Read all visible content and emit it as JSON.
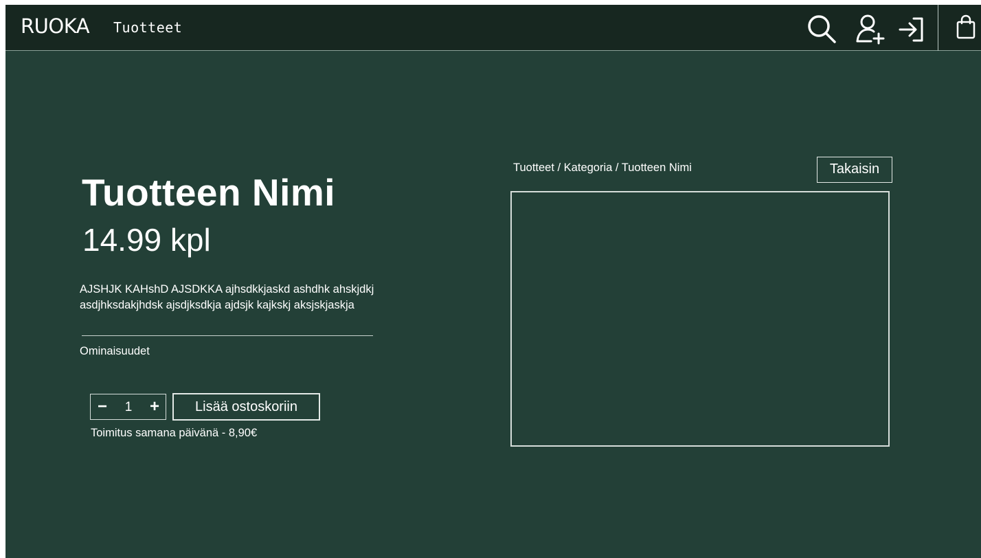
{
  "header": {
    "logo": "RUOKA",
    "nav_link": "Tuotteet",
    "icons": [
      "search-icon",
      "user-add-icon",
      "login-icon",
      "shopping-bag-icon"
    ]
  },
  "product": {
    "title": "Tuotteen Nimi",
    "price": "14.99 kpl",
    "description": "AJSHJK KAHshD AJSDKKA ajhsdkkjaskd ashdhk ahskjdkj asdjhksdakjhdsk ajsdjksdkja ajdsjk kajkskj aksjskjaskja",
    "features_label": "Ominaisuudet",
    "quantity": "1",
    "quantity_minus": "−",
    "quantity_plus": "+",
    "add_to_cart_label": "Lisää ostoskoriin",
    "delivery_info": "Toimitus samana päivänä - 8,90€"
  },
  "breadcrumb": "Tuotteet / Kategoria / Tuotteen Nimi",
  "back_button_label": "Takaisin",
  "colors": {
    "background": "#234037",
    "header": "#172720",
    "text": "#ffffff"
  }
}
